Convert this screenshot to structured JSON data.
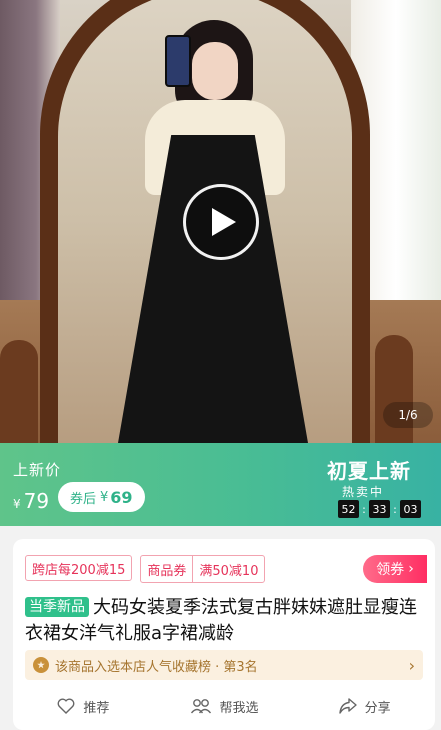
{
  "hero": {
    "page_indicator": "1/6",
    "play_icon": "play-icon"
  },
  "banner": {
    "price_label": "上新价",
    "currency": "¥",
    "original_price": "79",
    "after_coupon_label": "券后",
    "after_coupon_currency": "¥",
    "after_coupon_price": "69",
    "promo_title": "初夏上新",
    "hot_sale": "热卖中",
    "countdown": [
      "52",
      "33",
      "03"
    ],
    "accent_color": "#49bd94"
  },
  "card": {
    "coupons": [
      {
        "label": "跨店每200减15"
      },
      {
        "label": "商品券"
      },
      {
        "label": "满50减10"
      }
    ],
    "coupon_button": "领券",
    "new_badge": "当季新品",
    "title": "大码女装夏季法式复古胖妹妹遮肚显瘦连衣裙女洋气礼服a字裙减龄",
    "rank_text": "该商品入选本店人气收藏榜 · 第3名",
    "actions": [
      {
        "label": "推荐",
        "icon": "heart-icon"
      },
      {
        "label": "帮我选",
        "icon": "people-icon"
      },
      {
        "label": "分享",
        "icon": "share-icon"
      }
    ],
    "brand_color": "#ff2e63"
  }
}
